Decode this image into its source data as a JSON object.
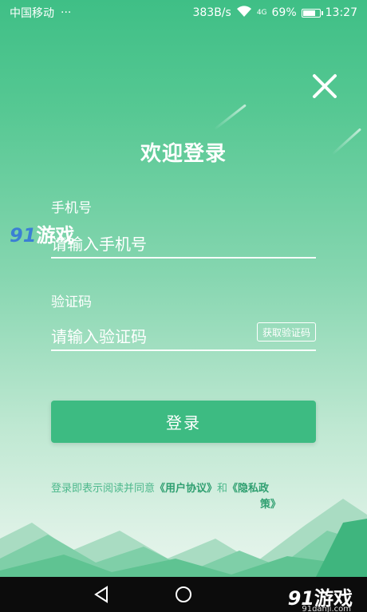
{
  "status_bar": {
    "carrier": "中国移动",
    "dots": "···",
    "speed": "383B/s",
    "network": "4G",
    "battery": "69%",
    "time": "13:27"
  },
  "title": "欢迎登录",
  "phone": {
    "label": "手机号",
    "placeholder": "请输入手机号"
  },
  "code": {
    "label": "验证码",
    "placeholder": "请输入验证码",
    "button": "获取验证码"
  },
  "login_button": "登录",
  "agreement": {
    "prefix": "登录即表示阅读并同意",
    "user_agreement": "《用户协议》",
    "and": "和",
    "privacy_line1": "《隐私政",
    "privacy_line2": "策》"
  },
  "watermarks": {
    "top_left_number": "91",
    "top_left_text": "游戏",
    "bottom_right_number": "91",
    "bottom_right_text": "游戏",
    "bottom_right_url": "91danji.com"
  },
  "icons": {
    "close": "close-icon",
    "back": "back-triangle-icon",
    "home": "home-circle-icon",
    "wifi": "wifi-icon",
    "battery": "battery-icon"
  },
  "colors": {
    "primary_green": "#3dbb82",
    "link_green": "#2f9f70",
    "background_top": "#3fbf86"
  }
}
